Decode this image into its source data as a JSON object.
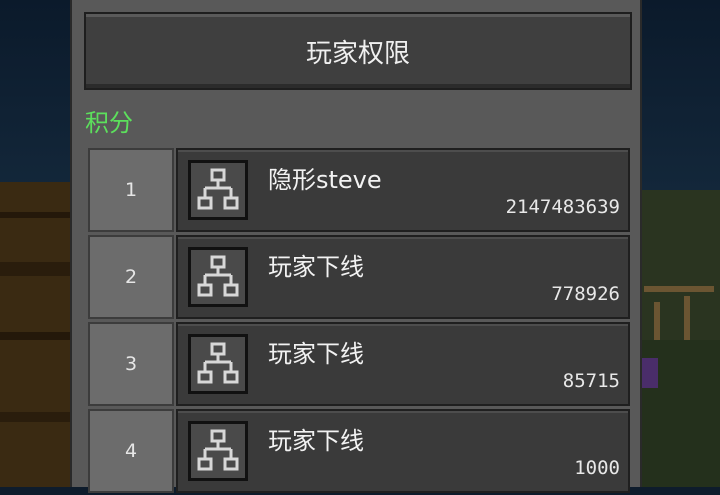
{
  "header": {
    "permissions_label": "玩家权限"
  },
  "scoreboard": {
    "title": "积分",
    "rows": [
      {
        "rank": "1",
        "name": "隐形steve",
        "score": "2147483639",
        "icon": "network-icon"
      },
      {
        "rank": "2",
        "name": "玩家下线",
        "score": "778926",
        "icon": "network-icon"
      },
      {
        "rank": "3",
        "name": "玩家下线",
        "score": "85715",
        "icon": "network-icon"
      },
      {
        "rank": "4",
        "name": "玩家下线",
        "score": "1000",
        "icon": "network-icon"
      }
    ]
  },
  "colors": {
    "panel": "#595959",
    "button": "#3f3f3f",
    "section_title": "#5ce05c",
    "rank_cell": "#6c6c6c",
    "player_cell": "#3a3a3a"
  }
}
